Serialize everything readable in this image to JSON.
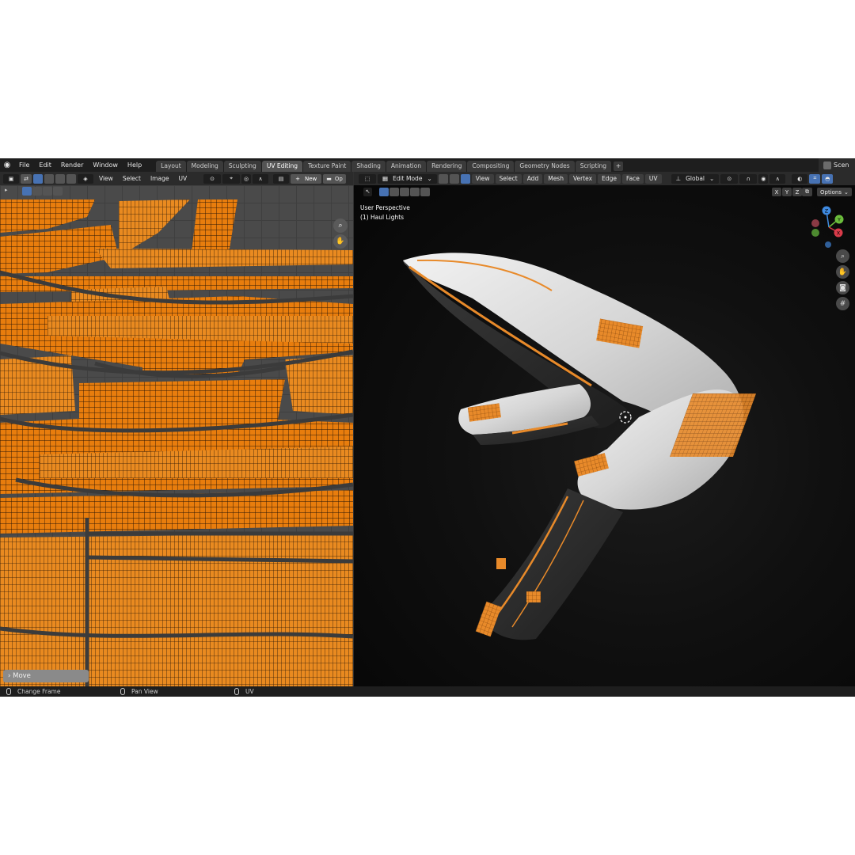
{
  "menu": [
    "File",
    "Edit",
    "Render",
    "Window",
    "Help"
  ],
  "workspaces": [
    {
      "label": "Layout",
      "active": false
    },
    {
      "label": "Modeling",
      "active": false
    },
    {
      "label": "Sculpting",
      "active": false
    },
    {
      "label": "UV Editing",
      "active": true
    },
    {
      "label": "Texture Paint",
      "active": false
    },
    {
      "label": "Shading",
      "active": false
    },
    {
      "label": "Animation",
      "active": false
    },
    {
      "label": "Rendering",
      "active": false
    },
    {
      "label": "Compositing",
      "active": false
    },
    {
      "label": "Geometry Nodes",
      "active": false
    },
    {
      "label": "Scripting",
      "active": false
    }
  ],
  "workspace_add": "+",
  "scene_label": "Scen",
  "uv_editor": {
    "menus": [
      "View",
      "Select",
      "Image",
      "UV"
    ],
    "new_label": "New",
    "new_plus": "+",
    "open_label": "Op",
    "move_panel": "Move"
  },
  "viewport": {
    "mode": "Edit Mode",
    "menus": [
      "View",
      "Select",
      "Add",
      "Mesh",
      "Vertex",
      "Edge",
      "Face",
      "UV"
    ],
    "transform_orientation": "Global",
    "axes_lock": [
      "X",
      "Y",
      "Z"
    ],
    "options_label": "Options",
    "perspective_label": "User Perspective",
    "object_label": "(1) Haul Lights",
    "gizmo_axes": [
      "Z",
      "Y",
      "X"
    ]
  },
  "status_bar": [
    {
      "label": "Change Frame"
    },
    {
      "label": "Pan View"
    },
    {
      "label": "UV"
    }
  ],
  "colors": {
    "uv_orange": "#e87d0d",
    "accent_blue": "#4772b3",
    "axis_x": "#d93b4a",
    "axis_y": "#6bbd3c",
    "axis_z": "#3f8ae0"
  }
}
